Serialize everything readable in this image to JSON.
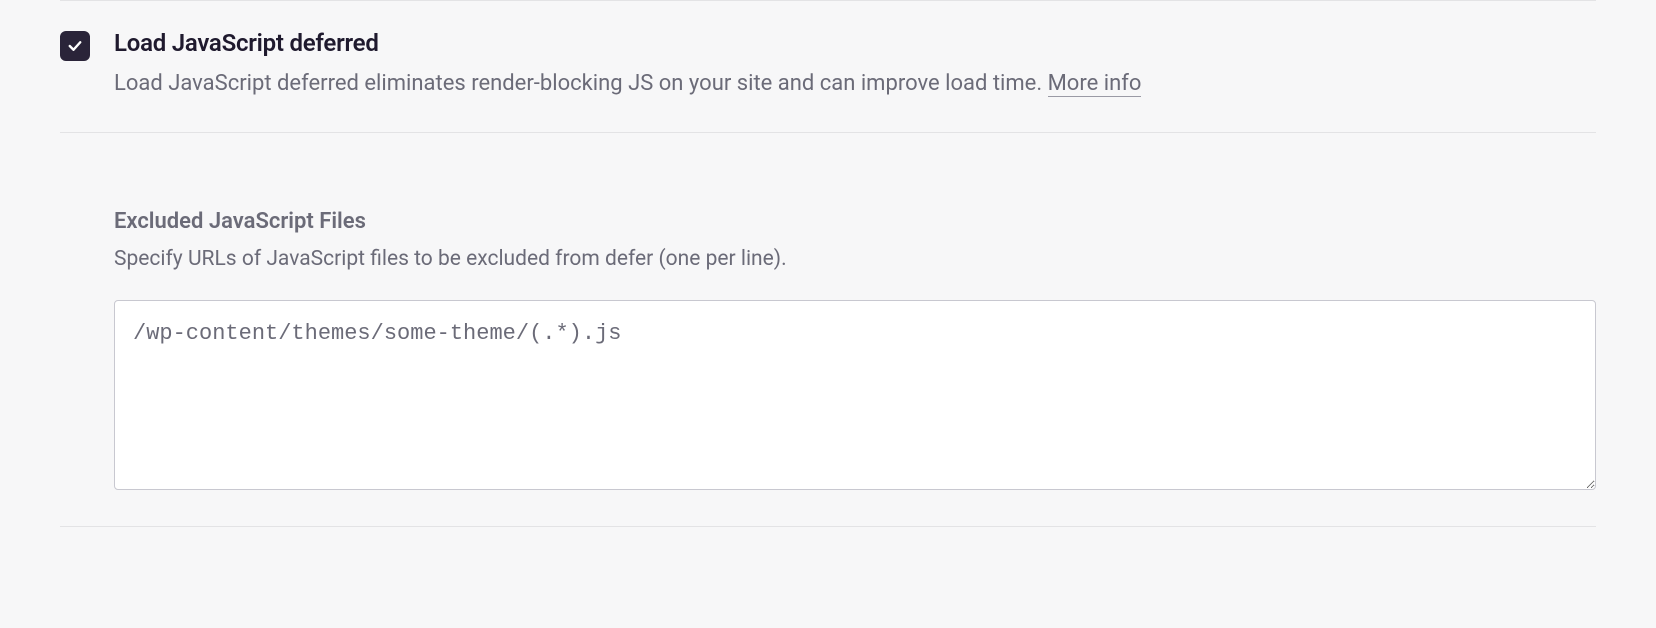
{
  "option": {
    "checked": true,
    "title": "Load JavaScript deferred",
    "description": "Load JavaScript deferred eliminates render-blocking JS on your site and can improve load time. ",
    "more_info_label": "More info"
  },
  "excluded": {
    "title": "Excluded JavaScript Files",
    "description": "Specify URLs of JavaScript files to be excluded from defer (one per line).",
    "value": "/wp-content/themes/some-theme/(.*).js"
  }
}
